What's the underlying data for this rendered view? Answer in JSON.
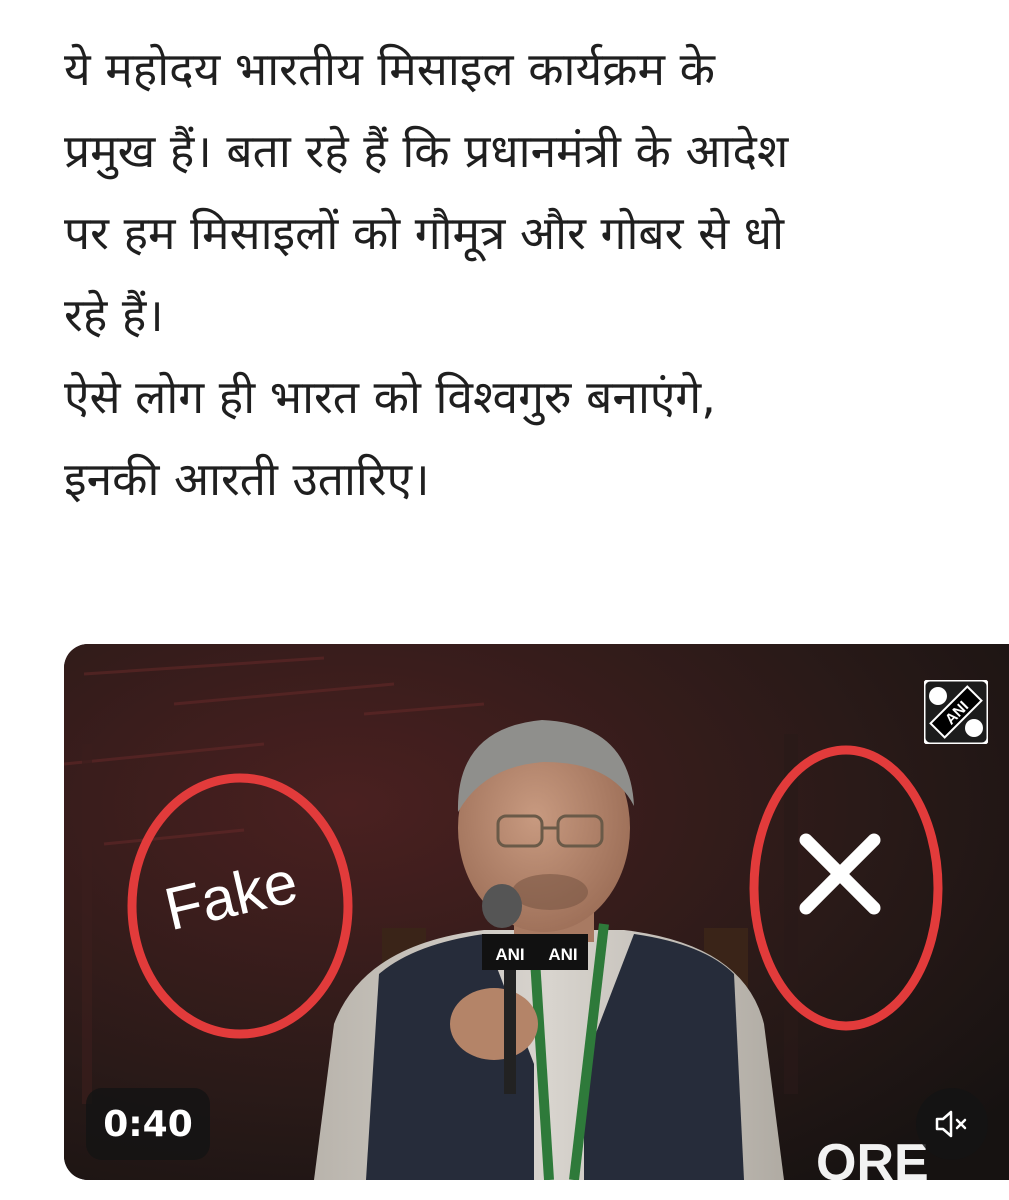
{
  "post": {
    "lines": [
      "ये महोदय भारतीय मिसाइल कार्यक्रम के",
      "प्रमुख हैं। बता रहे हैं कि प्रधानमंत्री के आदेश",
      "पर हम मिसाइलों को गौमूत्र और गोबर से धो",
      "रहे हैं।",
      "ऐसे लोग ही भारत को विश्वगुरु बनाएंगे,",
      "इनकी आरती उतारिए।"
    ]
  },
  "video": {
    "duration": "0:40",
    "overlay_label": "Fake",
    "mic_brand": "ANI",
    "watermark_brand": "ANI",
    "backdrop_letters": "ORE",
    "icons": {
      "mute": "speaker-muted-icon",
      "cross": "cross-mark-icon",
      "watermark": "ani-logo-icon"
    },
    "colors": {
      "annotation_red": "#e23b3b",
      "vest": "#262c3a",
      "backdrop": "#1c1615"
    }
  }
}
